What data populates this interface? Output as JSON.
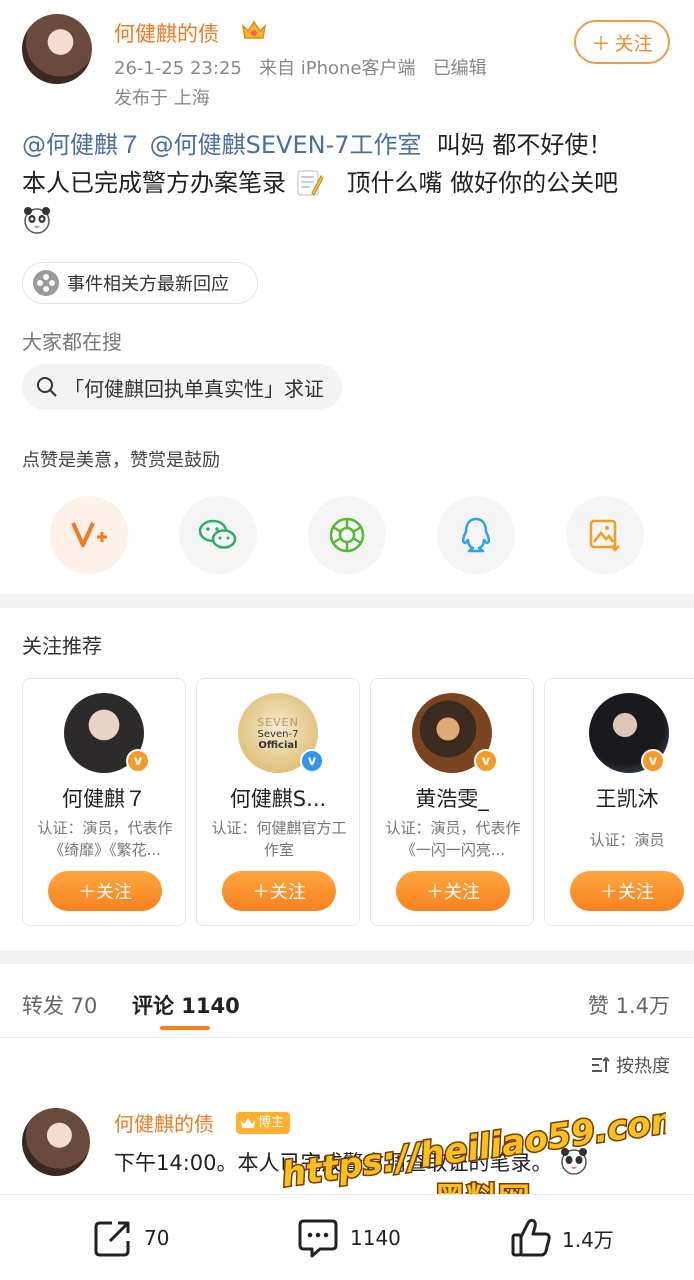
{
  "post": {
    "author": "何健麒的债",
    "timestamp": "26-1-25 23:25",
    "source": "来自 iPhone客户端",
    "edited": "已编辑",
    "location": "发布于 上海",
    "follow_label": "关注",
    "mention_1": "@何健麒７",
    "mention_2": "@何健麒SEVEN-7工作室",
    "text_line1": "叫妈 都不好使！",
    "text_line2a": "本人已完成警方办案笔录",
    "text_line2b": "顶什么嘴 做好你的公关吧",
    "event_chip": "事件相关方最新回应"
  },
  "search": {
    "title": "大家都在搜",
    "query": "「何健麒回执单真实性」求证"
  },
  "reward": {
    "tip": "点赞是美意，赞赏是鼓励"
  },
  "share_icons": [
    "reward-v-icon",
    "wechat-icon",
    "moments-icon",
    "qq-icon",
    "save-image-icon"
  ],
  "recommend": {
    "title": "关注推荐",
    "follow_label": "关注",
    "cards": [
      {
        "name": "何健麒７",
        "desc": "认证：演员，代表作《绮靡》《繁花...",
        "badge": "orange"
      },
      {
        "name": "何健麒S...",
        "desc": "认证：何健麒官方工作室",
        "badge": "blue",
        "logo_line1": "SEVEN",
        "logo_line2": "Seven-7",
        "logo_line3": "Official"
      },
      {
        "name": "黄浩雯_",
        "desc": "认证：演员，代表作《一闪一闪亮...",
        "badge": "orange"
      },
      {
        "name": "王凯沐",
        "desc": "认证：演员",
        "badge": "orange"
      }
    ]
  },
  "tabs": {
    "repost": "转发 70",
    "comment": "评论 1140",
    "like": "赞 1.4万",
    "sort": "按热度"
  },
  "comment": {
    "author": "何健麒的债",
    "badge": "博主",
    "text": "下午14:00。本人已完成警方调查取证的笔录。"
  },
  "watermark": {
    "line1": "https://heiliao59.com",
    "line2": "黑料网"
  },
  "bottom": {
    "repost_count": "70",
    "comment_count": "1140",
    "like_count": "1.4万"
  },
  "colors": {
    "accent": "#f7821f",
    "mention": "#4a6fa5",
    "verified_orange": "#f39a28",
    "verified_blue": "#2e95f0"
  }
}
